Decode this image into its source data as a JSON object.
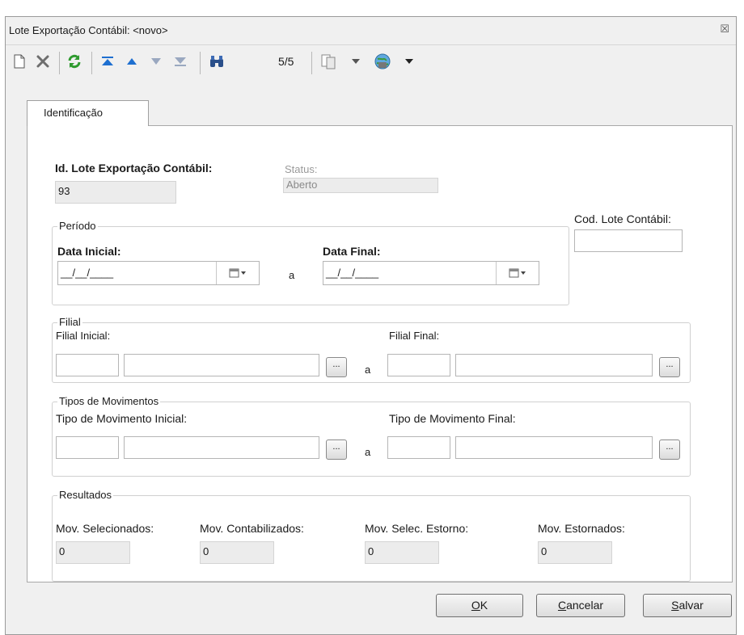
{
  "window": {
    "title": "Lote Exportação Contábil: <novo>",
    "close_glyph": "☒"
  },
  "toolbar": {
    "counter": "5/5",
    "icons": [
      "new-document-icon",
      "delete-icon",
      "refresh-icon",
      "first-record-icon",
      "previous-record-icon",
      "next-record-icon",
      "last-record-icon",
      "search-icon",
      "copy-icon",
      "dropdown-arrow-icon",
      "globe-icon",
      "dropdown-arrow-icon"
    ]
  },
  "tabs": [
    {
      "label": "Identificação"
    }
  ],
  "form": {
    "id_label": "Id. Lote Exportação Contábil:",
    "id_value": "93",
    "status_label": "Status:",
    "status_value": "Aberto",
    "cod_lote_label": "Cod. Lote Contábil:",
    "cod_lote_value": "",
    "periodo": {
      "title": "Período",
      "data_inicial_label": "Data Inicial:",
      "data_inicial_value": "__/__/____",
      "a": "a",
      "data_final_label": "Data Final:",
      "data_final_value": "__/__/____"
    },
    "filial": {
      "title": "Filial",
      "inicial_label": "Filial Inicial:",
      "final_label": "Filial Final:",
      "a": "a",
      "dots": "..."
    },
    "tipos": {
      "title": "Tipos de Movimentos",
      "inicial_label": "Tipo de Movimento Inicial:",
      "final_label": "Tipo de Movimento Final:",
      "a": "a",
      "dots": "..."
    },
    "resultados": {
      "title": "Resultados",
      "items": [
        {
          "label": "Mov. Selecionados:",
          "value": "0"
        },
        {
          "label": "Mov. Contabilizados:",
          "value": "0"
        },
        {
          "label": "Mov. Selec. Estorno:",
          "value": "0"
        },
        {
          "label": "Mov. Estornados:",
          "value": "0"
        }
      ]
    }
  },
  "buttons": {
    "ok_u": "O",
    "ok_rest": "K",
    "cancel_u": "C",
    "cancel_rest": "ancelar",
    "save_u": "S",
    "save_rest": "alvar"
  },
  "colors": {
    "accent_blue": "#1e6fd0",
    "refresh_green": "#2e9a2e"
  }
}
